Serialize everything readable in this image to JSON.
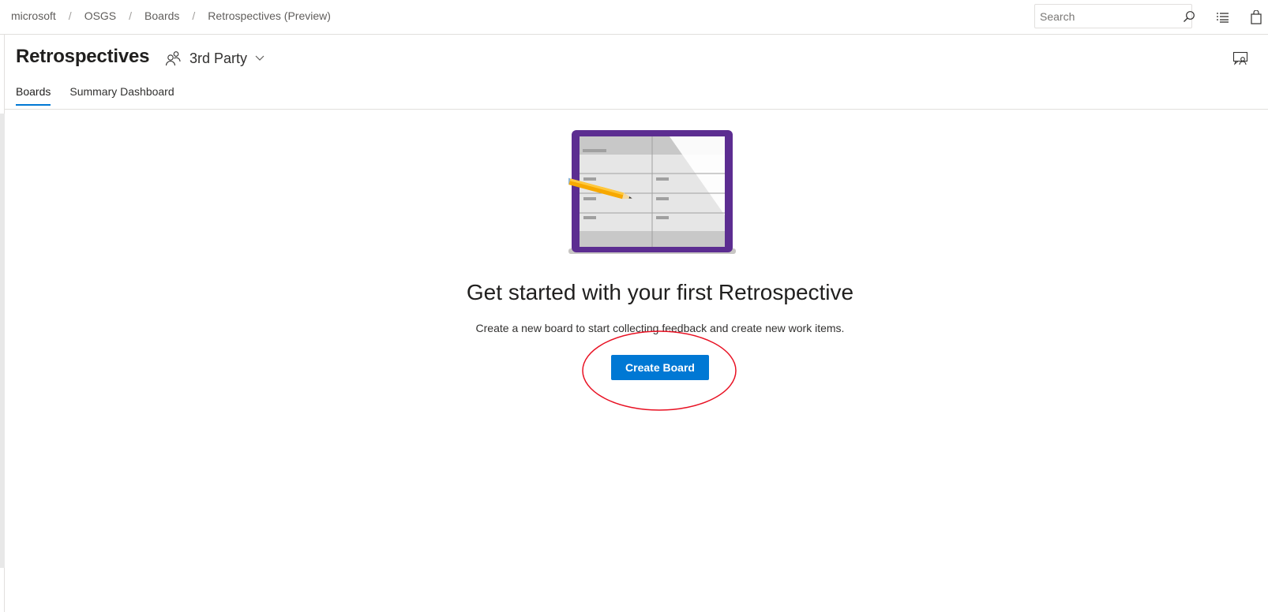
{
  "breadcrumb": {
    "items": [
      "microsoft",
      "OSGS",
      "Boards",
      "Retrospectives (Preview)"
    ],
    "separator": "/"
  },
  "search": {
    "placeholder": "Search",
    "value": ""
  },
  "icons": {
    "search": "search-icon",
    "list": "list-icon",
    "shopping_bag": "shopping-bag-icon",
    "team": "team-icon",
    "chevron": "chevron-down-icon",
    "feedback": "feedback-icon"
  },
  "header": {
    "title": "Retrospectives",
    "team_name": "3rd Party"
  },
  "tabs": [
    {
      "label": "Boards",
      "active": true
    },
    {
      "label": "Summary Dashboard",
      "active": false
    }
  ],
  "empty_state": {
    "title": "Get started with your first Retrospective",
    "description": "Create a new board to start collecting feedback and create new work items.",
    "button_label": "Create Board"
  },
  "colors": {
    "accent": "#0078d4",
    "illustration_frame": "#5c2d91",
    "annotation": "#e81123"
  }
}
